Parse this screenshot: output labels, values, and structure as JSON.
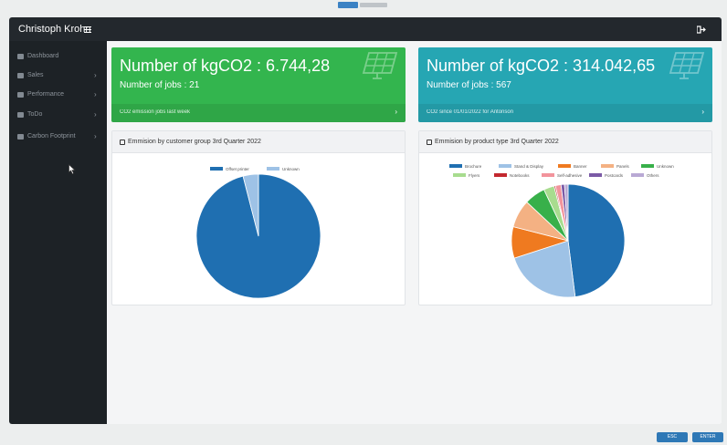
{
  "app": {
    "user_name": "Christoph Krohn"
  },
  "sidebar": {
    "items": [
      {
        "label": "Dashboard",
        "icon": "home-icon",
        "has_arrow": false
      },
      {
        "label": "Sales",
        "icon": "cart-icon",
        "has_arrow": true
      },
      {
        "label": "Performance",
        "icon": "chart-icon",
        "has_arrow": true
      },
      {
        "label": "ToDo",
        "icon": "pencil-icon",
        "has_arrow": true
      },
      {
        "label": "Carbon Footprint",
        "icon": "leaf-icon",
        "has_arrow": true
      }
    ]
  },
  "cards": [
    {
      "title": "Number of kgCO2 : 6.744,28",
      "subtitle": "Number of jobs : 21",
      "footer": "CO2 emission jobs last week",
      "color": "#33b54e"
    },
    {
      "title": "Number of kgCO2 : 314.042,65",
      "subtitle": "Number of jobs : 567",
      "footer": "CO2 since 01/01/2022 for Antonson",
      "color": "#26a6b3"
    }
  ],
  "panels": [
    {
      "title": "Emmision by customer group 3rd Quarter 2022"
    },
    {
      "title": "Emmision by product type 3rd Quarter 2022"
    }
  ],
  "chart_data": [
    {
      "type": "pie",
      "title": "Emmision by customer group 3rd Quarter 2022",
      "categories": [
        "Offset printer",
        "Unknown"
      ],
      "values": [
        96,
        4
      ],
      "colors": [
        "#1f6fb1",
        "#9ec2e6"
      ]
    },
    {
      "type": "pie",
      "title": "Emmision by product type 3rd Quarter 2022",
      "categories": [
        "Brochure",
        "Stand & Display",
        "Banner",
        "Panels",
        "Unknown",
        "Flyers",
        "Notebooks",
        "Self-adhesive",
        "Postcards",
        "Others"
      ],
      "values": [
        48,
        22,
        9,
        8,
        6,
        3,
        0.4,
        1.6,
        1,
        1
      ],
      "colors": [
        "#1f6fb1",
        "#9ec2e6",
        "#ef7a20",
        "#f4b183",
        "#38b04a",
        "#a8dc8f",
        "#c3282f",
        "#f2949c",
        "#7b5aa6",
        "#b9a9d4"
      ]
    }
  ],
  "buttons": {
    "esc": "ESC",
    "enter": "ENTER"
  }
}
